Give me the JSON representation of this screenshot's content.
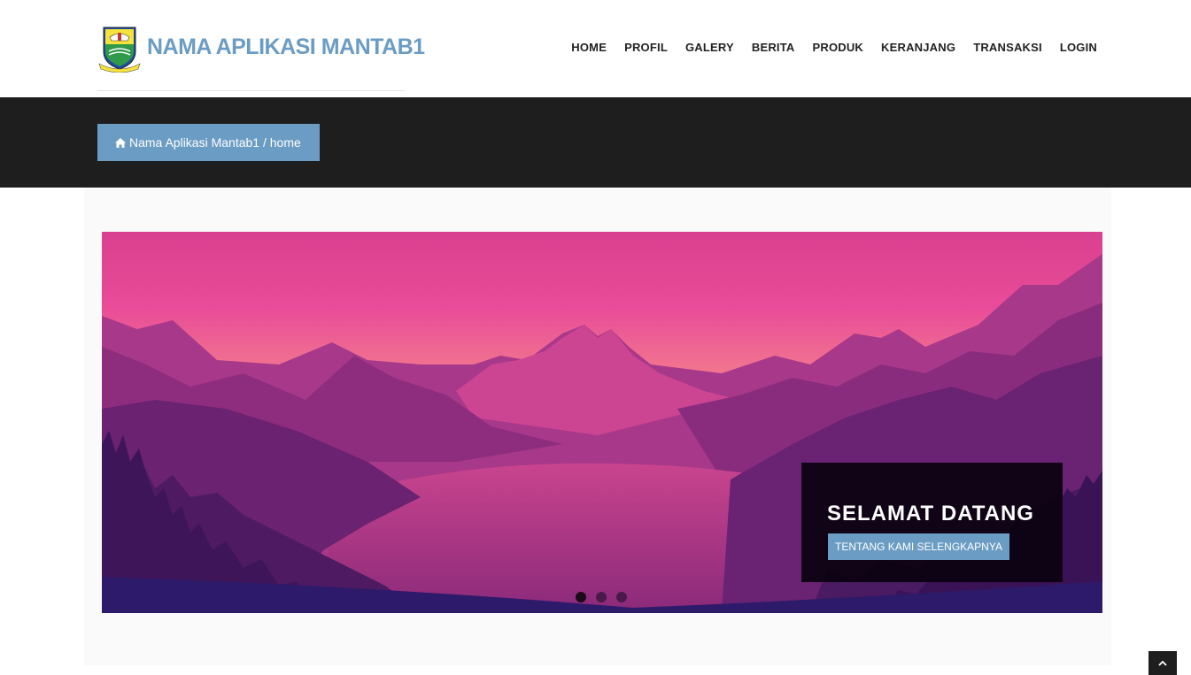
{
  "header": {
    "brand_title": "NAMA APLIKASI MANTAB1",
    "nav": [
      "HOME",
      "PROFIL",
      "GALERY",
      "BERITA",
      "PRODUK",
      "KERANJANG",
      "TRANSAKSI",
      "LOGIN"
    ]
  },
  "breadcrumb": {
    "text": "Nama Aplikasi Mantab1 / home",
    "icon": "home-icon"
  },
  "slider": {
    "caption_title": "SELAMAT DATANG",
    "caption_button": "TENTANG KAMI SELENGKAPNYA",
    "slide_count": 3,
    "active_slide": 1
  },
  "colors": {
    "accent": "#6b9cc4",
    "dark_bar": "#1e1e1e",
    "nav_text": "#222222"
  },
  "icons": {
    "back_to_top": "chevron-up-icon"
  }
}
